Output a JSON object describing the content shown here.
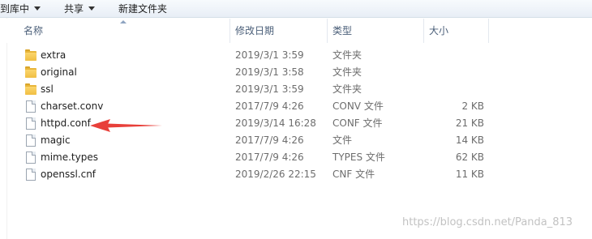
{
  "toolbar": {
    "include_library_label": "到库中",
    "share_label": "共享",
    "new_folder_label": "新建文件夹"
  },
  "columns": {
    "name": "名称",
    "date": "修改日期",
    "type": "类型",
    "size": "大小"
  },
  "files": [
    {
      "name": "extra",
      "date": "2019/3/1 3:59",
      "type": "文件夹",
      "size": "",
      "kind": "folder-icon"
    },
    {
      "name": "original",
      "date": "2019/3/1 3:58",
      "type": "文件夹",
      "size": "",
      "kind": "folder-icon"
    },
    {
      "name": "ssl",
      "date": "2019/3/1 3:59",
      "type": "文件夹",
      "size": "",
      "kind": "folder-icon"
    },
    {
      "name": "charset.conv",
      "date": "2017/7/9 4:26",
      "type": "CONV 文件",
      "size": "2 KB",
      "kind": "file-icon"
    },
    {
      "name": "httpd.conf",
      "date": "2019/3/14 16:28",
      "type": "CONF 文件",
      "size": "21 KB",
      "kind": "file-icon"
    },
    {
      "name": "magic",
      "date": "2017/7/9 4:26",
      "type": "文件",
      "size": "14 KB",
      "kind": "file-icon"
    },
    {
      "name": "mime.types",
      "date": "2017/7/9 4:26",
      "type": "TYPES 文件",
      "size": "62 KB",
      "kind": "file-icon"
    },
    {
      "name": "openssl.cnf",
      "date": "2019/2/26 22:15",
      "type": "CNF 文件",
      "size": "11 KB",
      "kind": "file-icon"
    }
  ],
  "annotation": {
    "kind": "red-arrow",
    "color": "#e8403a"
  },
  "watermark": "https://blog.csdn.net/Panda_813"
}
